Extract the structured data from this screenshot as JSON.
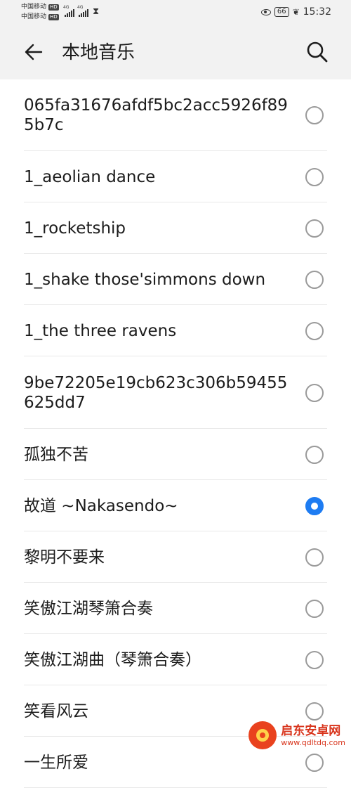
{
  "status_bar": {
    "carrier_1": "中国移动",
    "carrier_2": "中国移动",
    "hd": "HD",
    "network": "4G",
    "battery": "66",
    "time": "15:32"
  },
  "app_bar": {
    "title": "本地音乐",
    "back_icon": "back-arrow-icon",
    "search_icon": "search-icon"
  },
  "songs": [
    {
      "title": "065fa31676afdf5bc2acc5926f895b7c",
      "selected": false
    },
    {
      "title": "1_aeolian dance",
      "selected": false
    },
    {
      "title": "1_rocketship",
      "selected": false
    },
    {
      "title": "1_shake those'simmons down",
      "selected": false
    },
    {
      "title": "1_the three ravens",
      "selected": false
    },
    {
      "title": "9be72205e19cb623c306b59455625dd7",
      "selected": false
    },
    {
      "title": "孤独不苦",
      "selected": false
    },
    {
      "title": "故道 ~Nakasendo~",
      "selected": true
    },
    {
      "title": "黎明不要来",
      "selected": false
    },
    {
      "title": "笑傲江湖琴箫合奏",
      "selected": false
    },
    {
      "title": "笑傲江湖曲（琴箫合奏）",
      "selected": false
    },
    {
      "title": "笑看风云",
      "selected": false
    },
    {
      "title": "一生所爱",
      "selected": false
    }
  ],
  "colors": {
    "accent": "#1e7cf2",
    "header_bg": "#f2f2f2"
  },
  "watermark": {
    "name": "启东安卓网",
    "url": "www.qdltdq.com"
  }
}
